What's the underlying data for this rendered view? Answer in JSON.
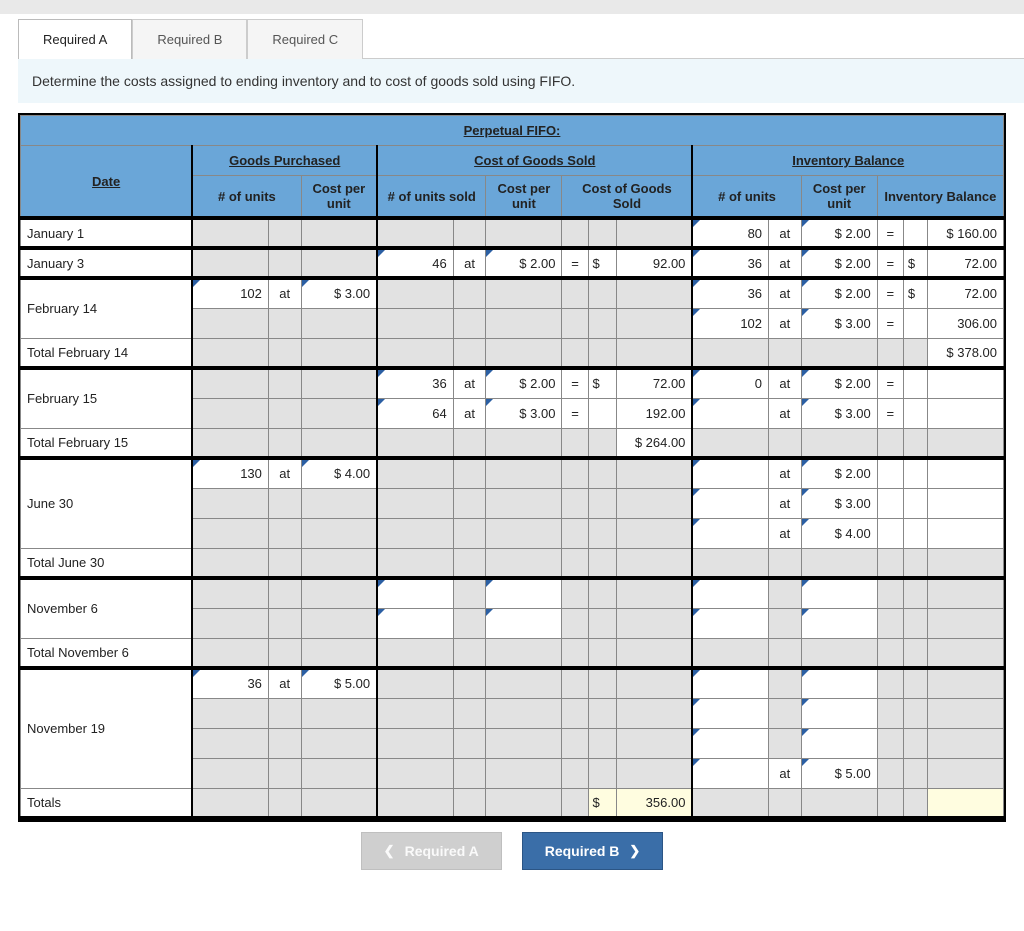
{
  "tabs": {
    "a": "Required A",
    "b": "Required B",
    "c": "Required C"
  },
  "instruction": "Determine the costs assigned to ending inventory and to cost of goods sold using FIFO.",
  "table_title": "Perpetual FIFO:",
  "sections": {
    "date": "Date",
    "gp": "Goods Purchased",
    "cogs": "Cost of Goods Sold",
    "ib": "Inventory Balance"
  },
  "cols": {
    "units": "# of units",
    "cpu": "Cost per unit",
    "units_sold": "# of units sold",
    "cogs_val": "Cost of Goods Sold",
    "inv_bal": "Inventory Balance"
  },
  "sym": {
    "at": "at",
    "eq": "=",
    "usd": "$"
  },
  "rows": {
    "jan1": {
      "date": "January 1",
      "ib_u": "80",
      "ib_c": "$   2.00",
      "ib_v": "$   160.00"
    },
    "jan3": {
      "date": "January 3",
      "cs_u": "46",
      "cs_c": "$   2.00",
      "cs_v": "92.00",
      "ib_u": "36",
      "ib_c": "$   2.00",
      "ib_v": "72.00"
    },
    "feb14a": {
      "date": "February 14",
      "gp_u": "102",
      "gp_c": "$   3.00",
      "ib_u": "36",
      "ib_c": "$   2.00",
      "ib_v": "72.00"
    },
    "feb14b": {
      "ib_u": "102",
      "ib_c": "$   3.00",
      "ib_v": "306.00"
    },
    "feb14t": {
      "date": "Total February 14",
      "ib_v": "$   378.00"
    },
    "feb15a": {
      "date": "February 15",
      "cs_u": "36",
      "cs_c": "$   2.00",
      "cs_v": "72.00",
      "ib_u": "0",
      "ib_c": "$   2.00"
    },
    "feb15b": {
      "cs_u": "64",
      "cs_c": "$   3.00",
      "cs_v": "192.00",
      "ib_c": "$   3.00"
    },
    "feb15t": {
      "date": "Total February 15",
      "cs_v": "$   264.00"
    },
    "jun30a": {
      "date": "June 30",
      "gp_u": "130",
      "gp_c": "$   4.00",
      "ib_c": "$   2.00"
    },
    "jun30b": {
      "ib_c": "$   3.00"
    },
    "jun30c": {
      "ib_c": "$   4.00"
    },
    "jun30t": {
      "date": "Total June 30"
    },
    "nov6": {
      "date": "November 6"
    },
    "nov6t": {
      "date": "Total November 6"
    },
    "nov19": {
      "date": "November 19",
      "gp_u": "36",
      "gp_c": "$   5.00",
      "ib_c": "$   5.00"
    },
    "totals": {
      "date": "Totals",
      "cs_v": "356.00"
    }
  },
  "nav": {
    "prev": "Required A",
    "next": "Required B"
  }
}
